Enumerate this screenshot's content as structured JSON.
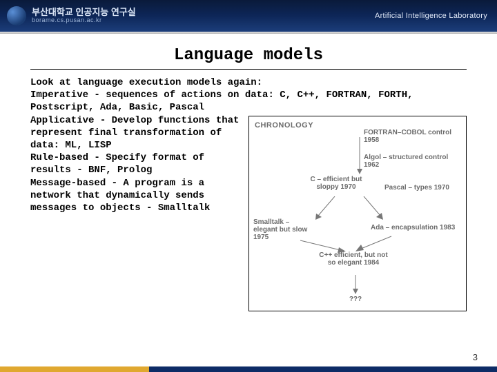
{
  "header": {
    "org_title": "부산대학교 인공지능 연구실",
    "org_sub": "borame.cs.pusan.ac.kr",
    "lab": "Artificial Intelligence Laboratory"
  },
  "slide": {
    "title": "Language models",
    "intro": "Look at language execution models again:",
    "imperative_label": "Imperative",
    "imperative_text": " - sequences of actions on data: C, C++, FORTRAN, FORTH, Postscript, Ada, Basic, Pascal",
    "applicative_label": "Applicative",
    "applicative_text": " - Develop functions that represent final transformation of data: ML, LISP",
    "rulebased_label": "Rule-based",
    "rulebased_text": " - Specify format of results - BNF, Prolog",
    "messagebased_label": "Message-based",
    "messagebased_text": " - A program is a network that dynamically sends messages to objects - Smalltalk"
  },
  "diagram": {
    "title": "CHRONOLOGY",
    "fortran": "FORTRAN–COBOL control 1958",
    "algol": "Algol – structured control 1962",
    "c": "C – efficient but sloppy 1970",
    "pascal": "Pascal – types 1970",
    "smalltalk": "Smalltalk – elegant but slow 1975",
    "ada": "Ada – encapsulation 1983",
    "cpp": "C++ efficient, but not so elegant 1984",
    "future": "???"
  },
  "page_number": "3"
}
